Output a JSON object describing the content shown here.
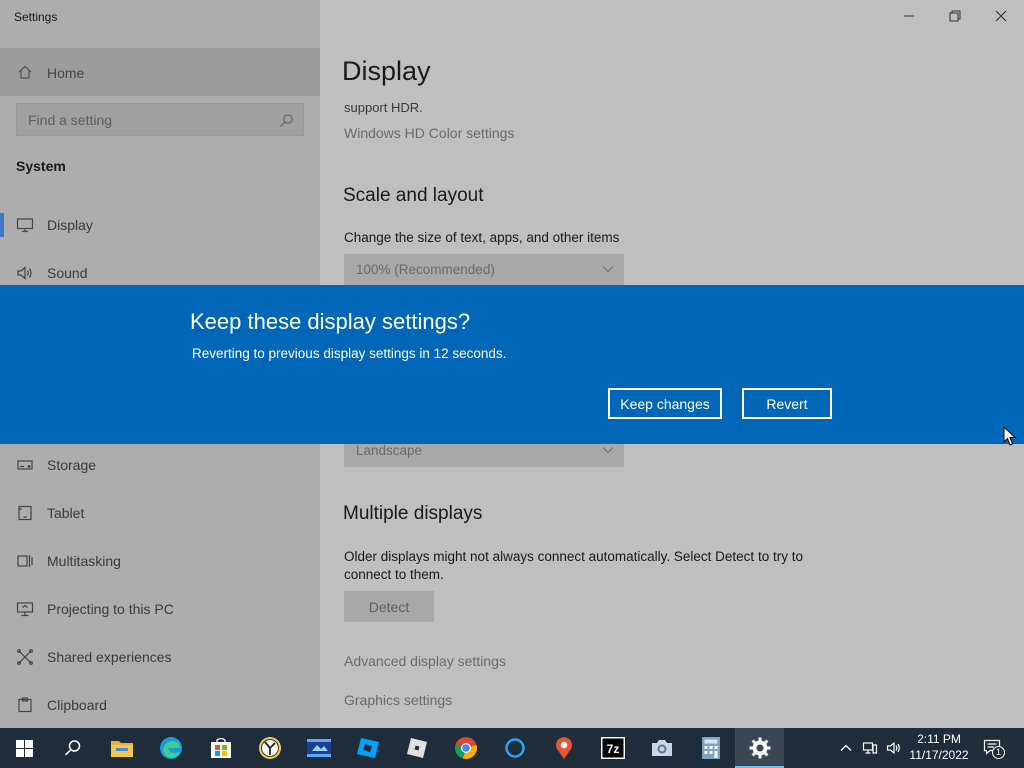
{
  "window": {
    "title": "Settings",
    "controls": [
      "minimize-icon",
      "restore-icon",
      "close-icon"
    ]
  },
  "sidebar": {
    "home_label": "Home",
    "search_placeholder": "Find a setting",
    "group_title": "System",
    "items": [
      {
        "label": "Display",
        "icon": "monitor-icon",
        "active": true
      },
      {
        "label": "Sound",
        "icon": "speaker-icon"
      },
      {
        "label": "Storage",
        "icon": "storage-icon"
      },
      {
        "label": "Tablet",
        "icon": "tablet-icon"
      },
      {
        "label": "Multitasking",
        "icon": "multitasking-icon"
      },
      {
        "label": "Projecting to this PC",
        "icon": "projecting-icon"
      },
      {
        "label": "Shared experiences",
        "icon": "shared-experiences-icon"
      },
      {
        "label": "Clipboard",
        "icon": "clipboard-icon"
      }
    ]
  },
  "main": {
    "title": "Display",
    "hdr_text": "support HDR.",
    "hdr_link": "Windows HD Color settings",
    "scale_section_title": "Scale and layout",
    "scale_label": "Change the size of text, apps, and other items",
    "scale_value": "100% (Recommended)",
    "orientation_value": "Landscape",
    "multiple_displays_title": "Multiple displays",
    "multiple_displays_desc": "Older displays might not always connect automatically. Select Detect to try to connect to them.",
    "detect_label": "Detect",
    "advanced_link": "Advanced display settings",
    "graphics_link": "Graphics settings"
  },
  "dialog": {
    "title": "Keep these display settings?",
    "message": "Reverting to previous display settings in 12 seconds.",
    "keep_label": "Keep changes",
    "revert_label": "Revert"
  },
  "taskbar": {
    "apps": [
      "start-icon",
      "search-icon",
      "file-explorer-icon",
      "edge-icon",
      "store-icon",
      "clock-app-icon",
      "video-editor-icon",
      "roblox-studio-icon",
      "roblox-icon",
      "chrome-icon",
      "cortana-icon",
      "maps-icon",
      "7zip-icon",
      "camera-icon",
      "calculator-icon",
      "settings-icon"
    ],
    "seven_zip_label": "7z",
    "time": "2:11 PM",
    "date": "11/17/2022",
    "notification_count": "1"
  },
  "colors": {
    "accent": "#0067b8",
    "taskbar": "#1f2c3a",
    "active_indicator": "#3e78c2"
  }
}
